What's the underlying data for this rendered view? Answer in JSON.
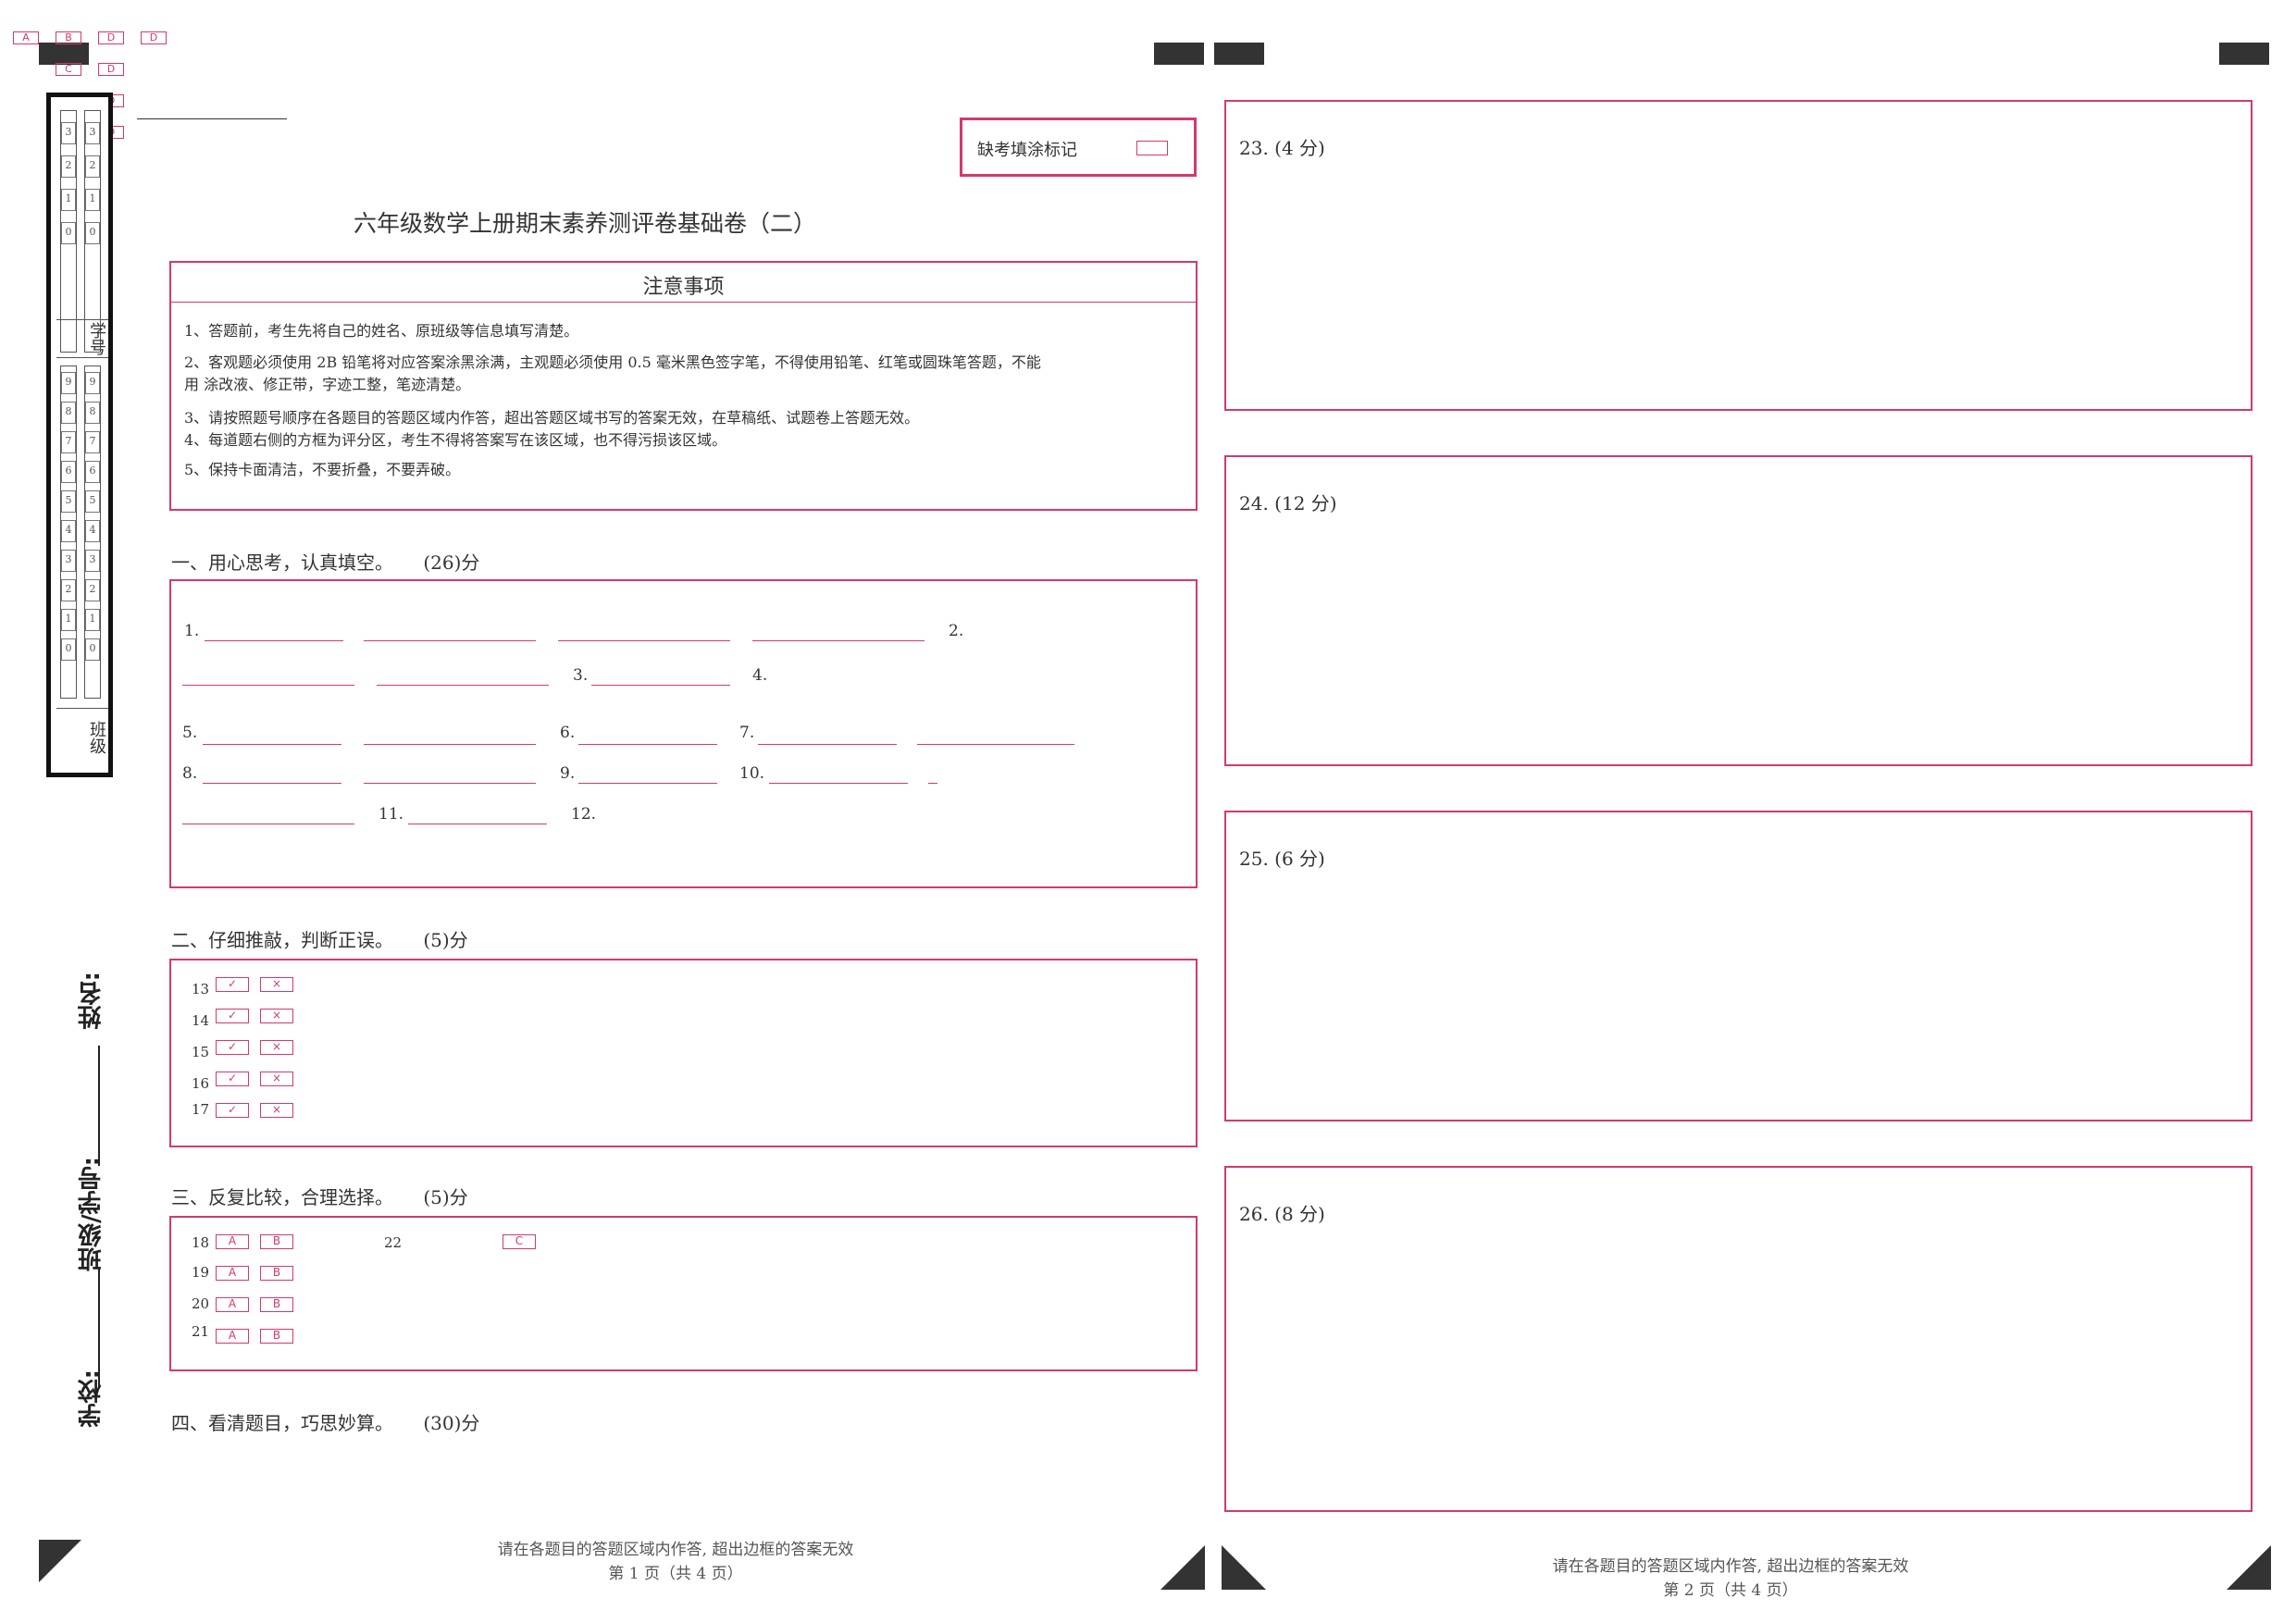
{
  "header": {
    "absent_label": "缺考填涂标记",
    "title": "六年级数学上册期末素养测评卷基础卷（二）"
  },
  "notice": {
    "title": "注意事项",
    "items": [
      "1、答题前，考生先将自己的姓名、原班级等信息填写清楚。",
      "2、客观题必须使用 2B 铅笔将对应答案涂黑涂满，主观题必须使用 0.5 毫米黑色签字笔，不得使用铅笔、红笔或圆珠笔答题，不能",
      "用 涂改液、修正带，字迹工整，笔迹清楚。",
      "3、请按照题号顺序在各题目的答题区域内作答，超出答题区域书写的答案无效，在草稿纸、试题卷上答题无效。",
      "4、每道题右侧的方框为评分区，考生不得将答案写在该区域，也不得污损该区域。",
      "5、保持卡面清洁，不要折叠，不要弄破。"
    ]
  },
  "sections": {
    "s1": {
      "title": "一、用心思考，认真填空。",
      "score": "(26)分"
    },
    "s2": {
      "title": "二、仔细推敲，判断正误。",
      "score": "(5)分"
    },
    "s3": {
      "title": "三、反复比较，合理选择。",
      "score": "(5)分"
    },
    "s4": {
      "title": "四、看清题目，巧思妙算。",
      "score": "(30)分"
    }
  },
  "fill_labels": {
    "q1": "1.",
    "q2": "2.",
    "q3": "3.",
    "q4": "4.",
    "q5": "5.",
    "q6": "6.",
    "q7": "7.",
    "q8": "8.",
    "q9": "9.",
    "q10": "10.",
    "q11": "11.",
    "q12": "12."
  },
  "judge": {
    "rows": [
      "13",
      "14",
      "15",
      "16",
      "17"
    ],
    "true_mark": "✓",
    "false_mark": "×"
  },
  "choice": {
    "rows": [
      "18",
      "19",
      "20",
      "21"
    ],
    "opt_a": "A",
    "opt_b": "B",
    "q22": "22",
    "q22_opt_c": "C"
  },
  "right_questions": [
    {
      "label": "23. (4 分)"
    },
    {
      "label": "24. (12 分)"
    },
    {
      "label": "25. (6 分)"
    },
    {
      "label": "26. (8 分)"
    }
  ],
  "side": {
    "student_id_label": "学号",
    "class_label": "班级",
    "name_label": "姓名:",
    "class_id_label": "班级/学号:",
    "school_label": "学校:",
    "digits": [
      "9",
      "8",
      "7",
      "6",
      "5",
      "4",
      "3",
      "2",
      "1",
      "0"
    ],
    "corner_a": "A",
    "corner_b": "B",
    "corner_c": "C",
    "corner_d": "D"
  },
  "footer": {
    "note": "请在各题目的答题区域内作答, 超出边框的答案无效",
    "page1": "第 1 页（共 4 页）",
    "page2": "第 2 页（共 4 页）"
  },
  "colors": {
    "accent": "#d23a6b",
    "ink": "#333333"
  }
}
